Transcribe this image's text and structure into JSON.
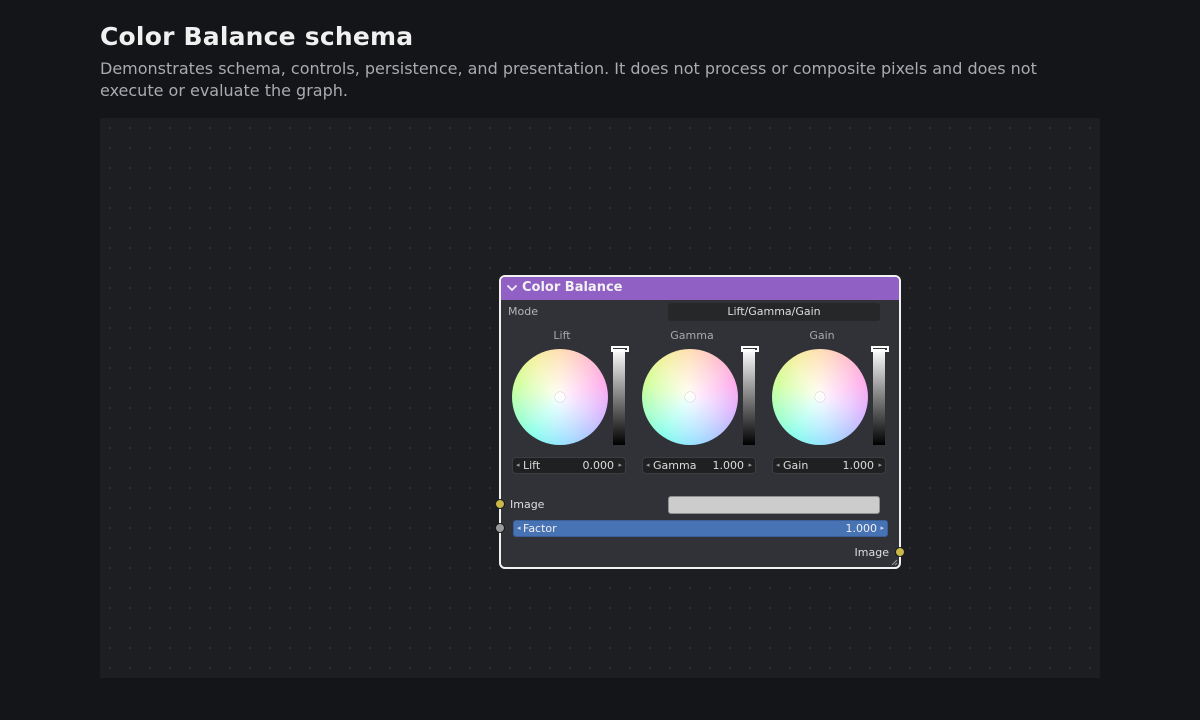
{
  "page": {
    "title": "Color Balance schema",
    "description": "Demonstrates schema, controls, persistence, and presentation. It does not process or composite pixels and does not execute or evaluate the graph."
  },
  "node": {
    "title": "Color Balance",
    "header_color": "#9060c4",
    "mode": {
      "label": "Mode",
      "value": "Lift/Gamma/Gain"
    },
    "wheels": [
      {
        "label": "Lift",
        "field_label": "Lift",
        "value": "0.000"
      },
      {
        "label": "Gamma",
        "field_label": "Gamma",
        "value": "1.000"
      },
      {
        "label": "Gain",
        "field_label": "Gain",
        "value": "1.000"
      }
    ],
    "inputs": {
      "image_label": "Image",
      "factor": {
        "label": "Factor",
        "value": "1.000",
        "color": "#4772b3"
      }
    },
    "outputs": {
      "image_label": "Image"
    },
    "socket_colors": {
      "image": "#c7b849",
      "factor": "#9a9a9a"
    }
  }
}
